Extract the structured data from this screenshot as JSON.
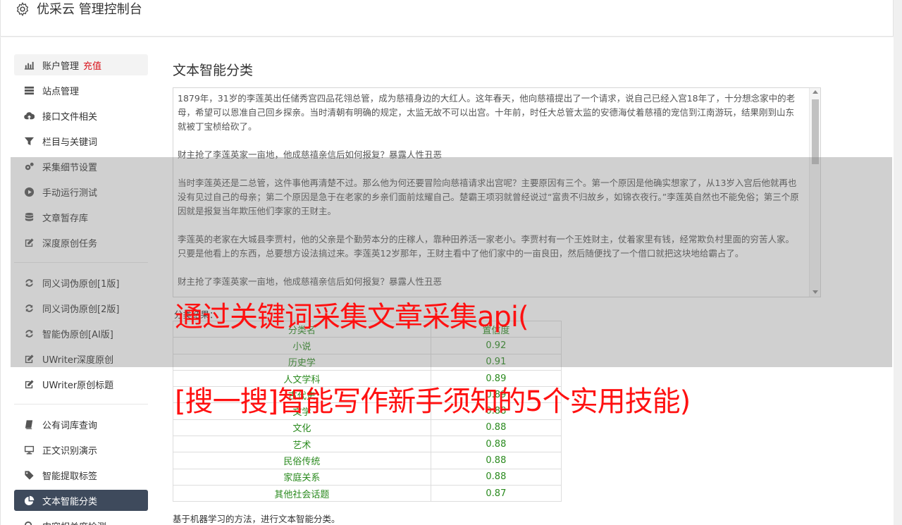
{
  "header": {
    "title": "优采云 管理控制台",
    "icon": "gear-icon"
  },
  "sidebar": {
    "items": [
      {
        "label": "账户管理",
        "badge": "充值",
        "icon": "bar-chart-icon"
      },
      {
        "label": "站点管理",
        "icon": "server-icon"
      },
      {
        "label": "接口文件相关",
        "icon": "cloud-upload-icon"
      },
      {
        "label": "栏目与关键词",
        "icon": "filter-icon"
      },
      {
        "label": "采集细节设置",
        "icon": "gears-icon"
      },
      {
        "label": "手动运行测试",
        "icon": "play-circle-icon"
      },
      {
        "label": "文章暂存库",
        "icon": "database-icon"
      },
      {
        "label": "深度原创任务",
        "icon": "edit-icon"
      },
      {
        "label": "同义词伪原创[1版]",
        "icon": "refresh-icon"
      },
      {
        "label": "同义词伪原创[2版]",
        "icon": "refresh-icon"
      },
      {
        "label": "智能伪原创[AI版]",
        "icon": "refresh-icon"
      },
      {
        "label": "UWriter深度原创",
        "icon": "edit-icon"
      },
      {
        "label": "UWriter原创标题",
        "icon": "edit-icon"
      },
      {
        "label": "公有词库查询",
        "icon": "book-icon"
      },
      {
        "label": "正文识别演示",
        "icon": "desktop-icon"
      },
      {
        "label": "智能提取标签",
        "icon": "tag-icon"
      },
      {
        "label": "文本智能分类",
        "icon": "pie-chart-icon"
      },
      {
        "label": "内容相关度检测",
        "icon": "search-icon"
      }
    ]
  },
  "main": {
    "title": "文本智能分类",
    "text_paragraphs": [
      "1879年，31岁的李莲英出任储秀宫四品花翎总管，成为慈禧身边的大红人。这年春天，他向慈禧提出了一个请求，说自己已经入宫18年了，十分想念家中的老母，希望可以恩准自己回乡探亲。当时清朝有明确的规定，太监无故不可以出宫。十年前，时任大总管太监的安德海仗着慈禧的宠信到江南游玩，结果刚到山东就被丁宝桢给砍了。",
      "财主抢了李莲英家一亩地，他成慈禧亲信后如何报复？暴露人性丑恶",
      "当时李莲英还是二总管，这件事他再清楚不过。那么他为何还要冒险向慈禧请求出宫呢？主要原因有三个。第一个原因是他确实想家了，从13岁入宫后他就再也没有见过自己的母亲；第二个原因是急于在老家的乡亲们面前炫耀自己。楚霸王项羽就曾经说过“富贵不归故乡，如锦衣夜行。”李莲英自然也不能免俗；第三个原因就是报复当年欺压他们李家的王财主。",
      "李莲英的老家在大城县李贾村，他的父亲是个勤劳本分的庄稼人，靠种田养活一家老小。李贾村有一个王姓财主，仗着家里有钱，经常欺负村里面的穷苦人家。只要是他看上的东西，总要想方设法搞过来。李莲英12岁那年，王财主看中了他们家中的一亩良田，然后随便找了一个借口就把这块地给霸占了。",
      "财主抢了李莲英家一亩地，他成慈禧亲信后如何报复？暴露人性丑恶"
    ],
    "result_label": "分类结果：",
    "table": {
      "headers": [
        "分类名",
        "置信度"
      ],
      "rows": [
        [
          "小说",
          "0.92"
        ],
        [
          "历史学",
          "0.91"
        ],
        [
          "人文学科",
          "0.89"
        ],
        [
          "古代史",
          "0.89"
        ],
        [
          "文学",
          "0.88"
        ],
        [
          "文化",
          "0.88"
        ],
        [
          "艺术",
          "0.88"
        ],
        [
          "民俗传统",
          "0.88"
        ],
        [
          "家庭关系",
          "0.88"
        ],
        [
          "其他社会话题",
          "0.87"
        ]
      ]
    },
    "footer_note": "基于机器学习的方法，进行文本智能分类。"
  },
  "overlay": {
    "headline_1": "通过关键词采集文章采集api(",
    "headline_2": "[搜一搜]智能写作新手须知的5个实用技能)"
  },
  "colors": {
    "active_bg": "#3e4a5c",
    "badge": "#d9121b",
    "table_text": "#2a8a1e",
    "overlay_text": "#ff1111"
  }
}
